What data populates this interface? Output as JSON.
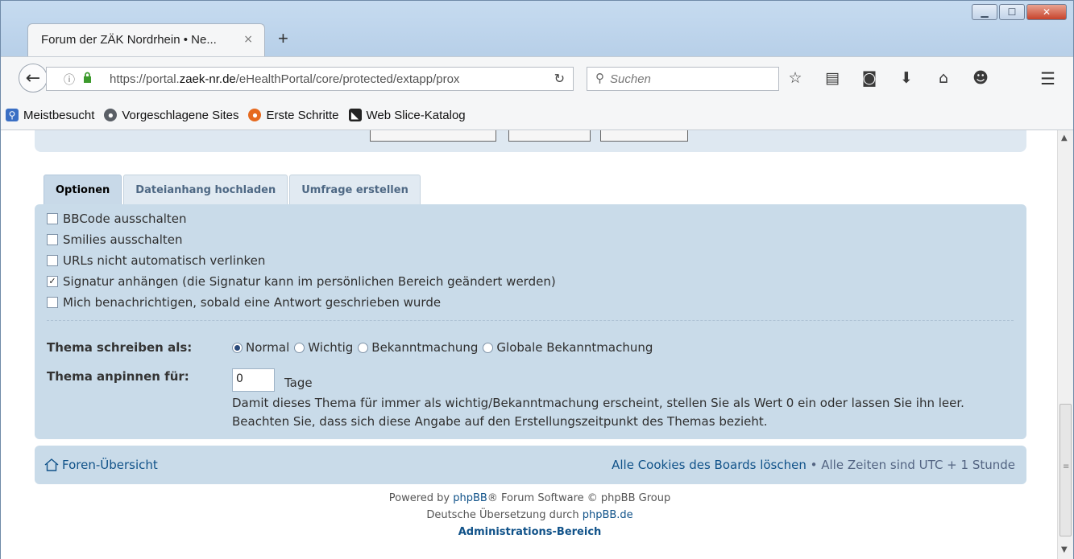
{
  "browser": {
    "tab_title": "Forum der ZÄK Nordrhein • Ne...",
    "tab_close": "×",
    "new_tab": "+",
    "url_prefix": "https://portal.",
    "url_domain": "zaek-nr.de",
    "url_rest": "/eHealthPortal/core/protected/extapp/prox",
    "search_placeholder": "Suchen",
    "bookmarks": [
      {
        "label": "Meistbesucht",
        "icon": "search-bookmark-icon",
        "color": "#3a6fc4"
      },
      {
        "label": "Vorgeschlagene Sites",
        "icon": "globe-icon",
        "color": "#5a5f66"
      },
      {
        "label": "Erste Schritte",
        "icon": "firefox-icon",
        "color": "#e66a1f"
      },
      {
        "label": "Web Slice-Katalog",
        "icon": "web-slice-icon",
        "color": "#222222"
      }
    ]
  },
  "tabs": [
    {
      "label": "Optionen",
      "active": true
    },
    {
      "label": "Dateianhang hochladen",
      "active": false
    },
    {
      "label": "Umfrage erstellen",
      "active": false
    }
  ],
  "options": [
    {
      "label": "BBCode ausschalten",
      "checked": false
    },
    {
      "label": "Smilies ausschalten",
      "checked": false
    },
    {
      "label": "URLs nicht automatisch verlinken",
      "checked": false
    },
    {
      "label": "Signatur anhängen (die Signatur kann im persönlichen Bereich geändert werden)",
      "checked": true
    },
    {
      "label": "Mich benachrichtigen, sobald eine Antwort geschrieben wurde",
      "checked": false
    }
  ],
  "topic_type": {
    "label": "Thema schreiben als:",
    "options": [
      "Normal",
      "Wichtig",
      "Bekanntmachung",
      "Globale Bekanntmachung"
    ],
    "selected": "Normal"
  },
  "pin": {
    "label": "Thema anpinnen für:",
    "value": "0",
    "unit": "Tage",
    "explain_1": "Damit dieses Thema für immer als wichtig/Bekanntmachung erscheint, stellen Sie als Wert 0 ein oder lassen Sie ihn leer.",
    "explain_2": "Beachten Sie, dass sich diese Angabe auf den Erstellungszeitpunkt des Themas bezieht."
  },
  "footer": {
    "home": "Foren-Übersicht",
    "delete_cookies": "Alle Cookies des Boards löschen",
    "separator": " • ",
    "timezone": "Alle Zeiten sind UTC + 1 Stunde",
    "powered_by": "Powered by ",
    "phpbb": "phpBB",
    "powered_rest": "® Forum Software © phpBB Group",
    "translation": "Deutsche Übersetzung durch ",
    "translation_link": "phpBB.de",
    "admin": "Administrations-Bereich"
  }
}
